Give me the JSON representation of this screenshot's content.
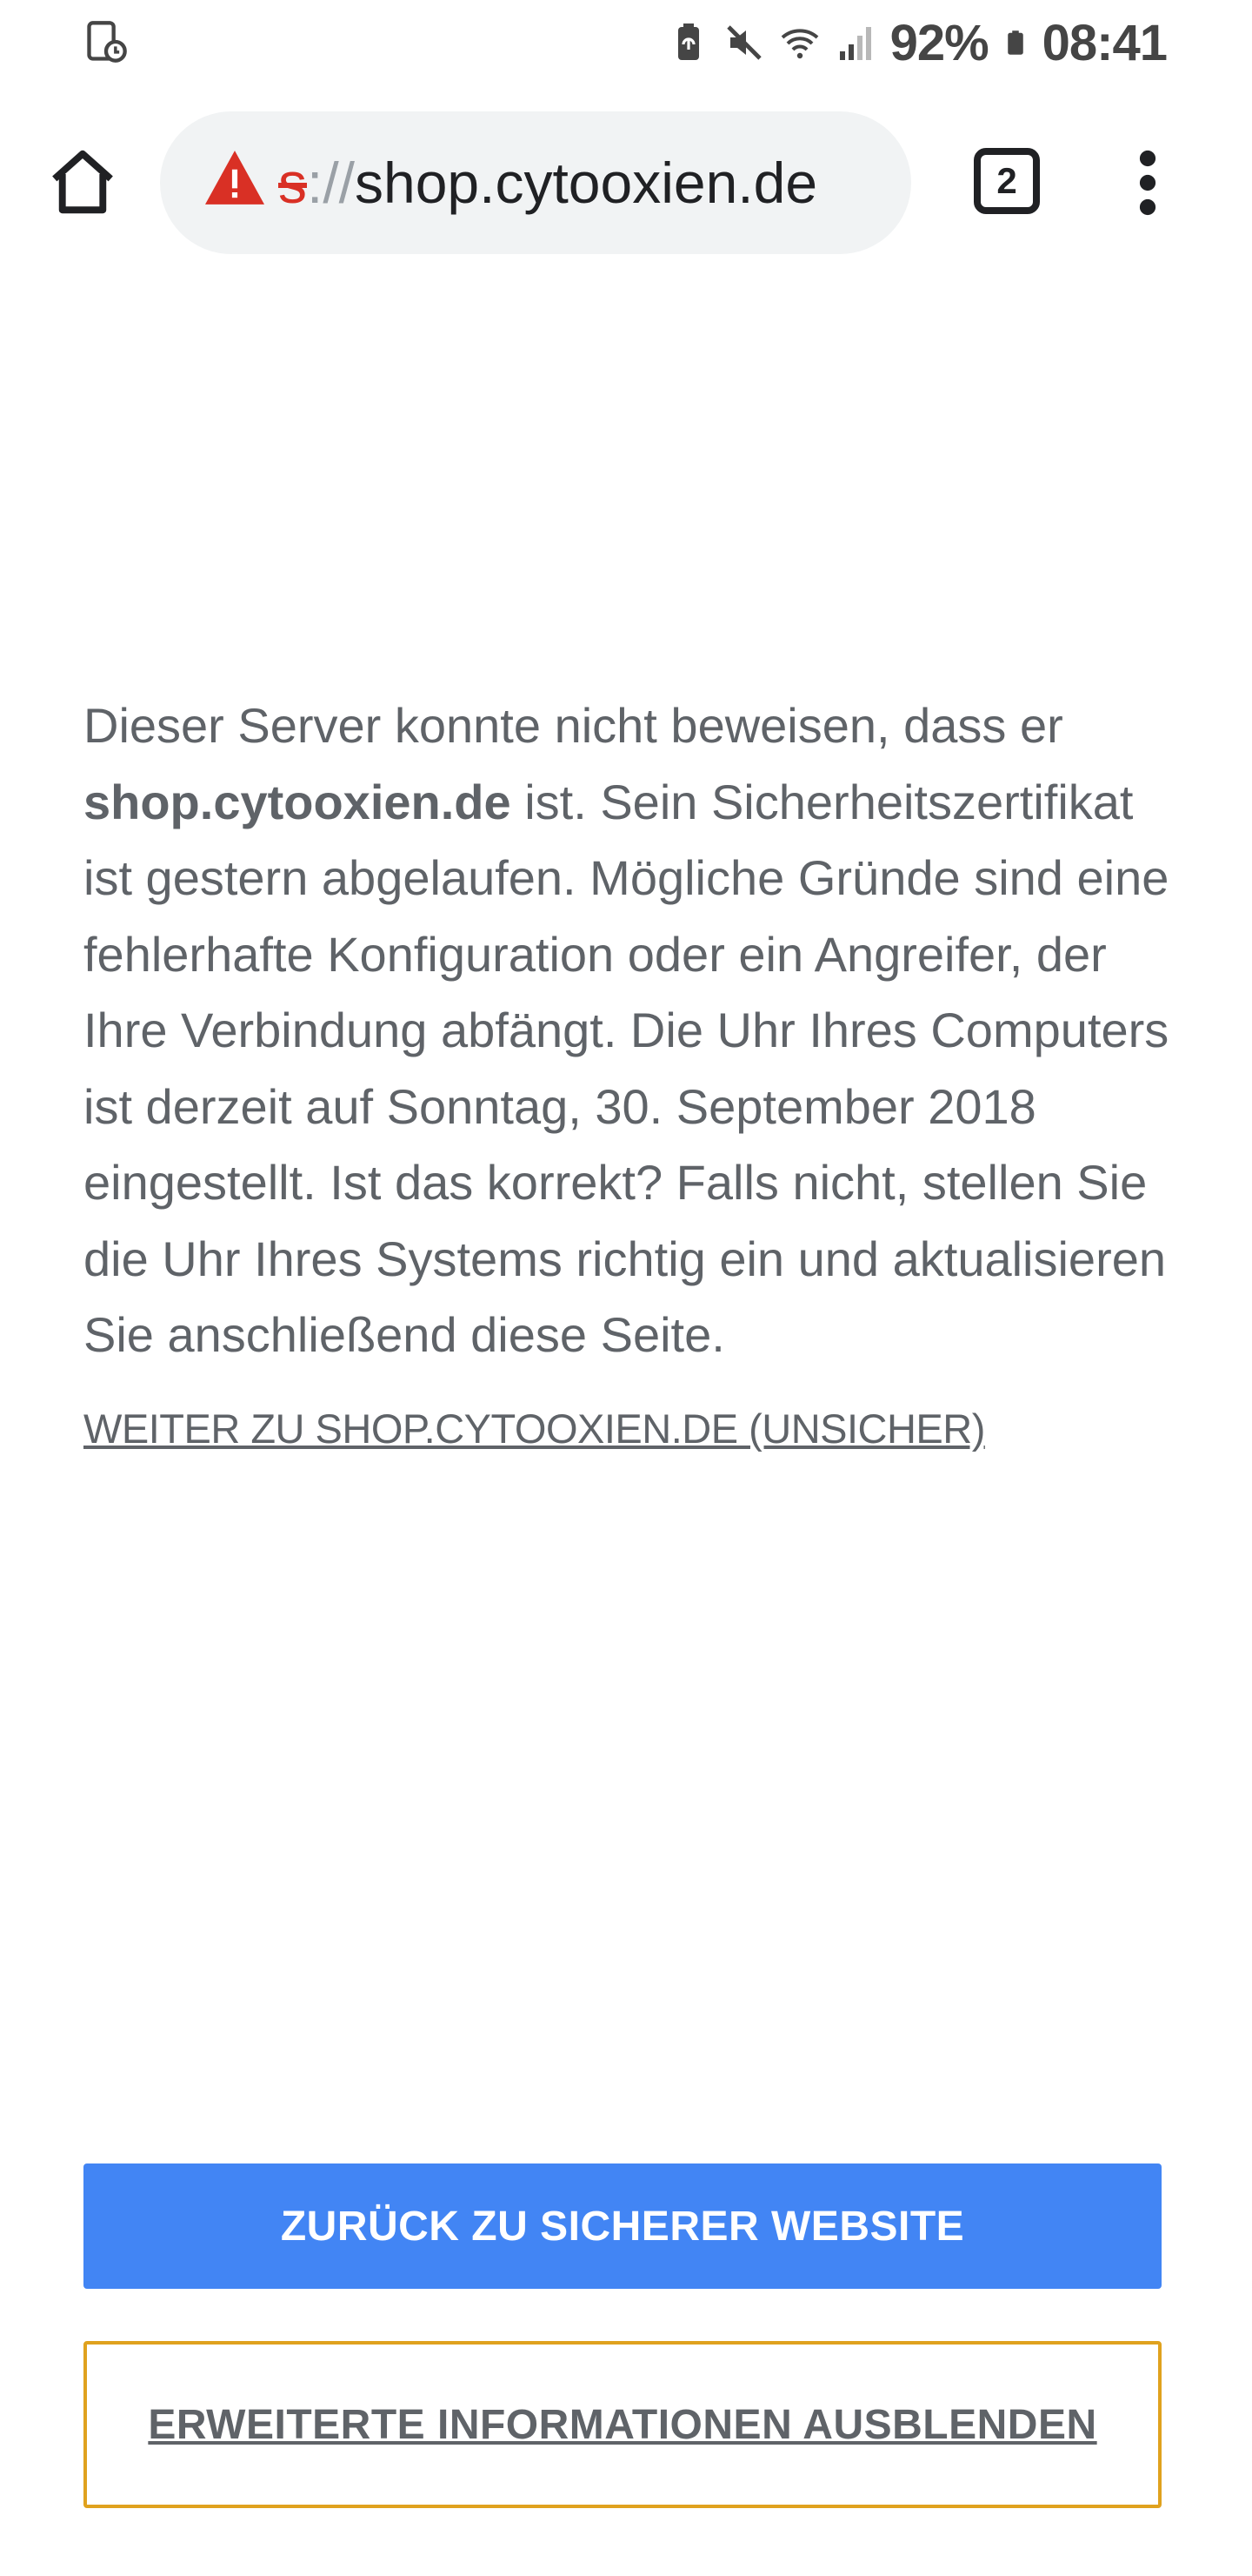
{
  "status_bar": {
    "battery_percent": "92%",
    "time": "08:41",
    "icons": [
      "tablet-clock-icon",
      "battery-saver-icon",
      "mute-icon",
      "wifi-icon",
      "signal-icon",
      "battery-icon"
    ]
  },
  "toolbar": {
    "url_scheme_tail": "s",
    "url_separator": "://",
    "url_host": "shop.cytooxien.de",
    "tab_count": "2",
    "icons": [
      "home-icon",
      "warning-icon",
      "more-vert-icon"
    ]
  },
  "interstitial": {
    "text_1": "Dieser Server konnte nicht beweisen, dass er ",
    "domain": "shop.cytooxien.de",
    "text_2": " ist. Sein Sicherheitszertifikat ist gestern abgelaufen. Mögliche Gründe sind eine fehlerhafte Konfiguration oder ein Angreifer, der Ihre Verbindung abfängt. Die Uhr Ihres Computers ist derzeit auf Sonntag, 30. September 2018 eingestellt. Ist das korrekt? Falls nicht, stellen Sie die Uhr Ihres Systems richtig ein und aktualisieren Sie anschließend diese Seite.",
    "proceed_link": "WEITER ZU SHOP.CYTOOXIEN.DE (UNSICHER)"
  },
  "buttons": {
    "primary": "ZURÜCK ZU SICHERER WEBSITE",
    "secondary": "ERWEITERTE INFORMATIONEN AUSBLENDEN"
  },
  "colors": {
    "primary_button": "#4285f4",
    "focus_outline": "#e0a21e",
    "warning_red": "#d93025",
    "body_text": "#5f6368"
  }
}
